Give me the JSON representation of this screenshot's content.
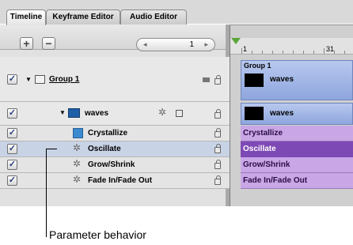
{
  "tabs": [
    "Timeline",
    "Keyframe Editor",
    "Audio Editor"
  ],
  "toolbar": {
    "add_label": "+",
    "remove_label": "−",
    "stepper_left": "◂",
    "stepper_value": "1",
    "stepper_right": "▸"
  },
  "layers": [
    {
      "name": "Group 1",
      "checked": true
    },
    {
      "name": "waves",
      "checked": true
    },
    {
      "name": "Crystallize",
      "checked": true
    },
    {
      "name": "Oscillate",
      "checked": true,
      "selected": true
    },
    {
      "name": "Grow/Shrink",
      "checked": true
    },
    {
      "name": "Fade In/Fade Out",
      "checked": true
    }
  ],
  "ruler": {
    "start": "1",
    "mark": "31"
  },
  "tracks": {
    "group_label": "Group 1",
    "group_clip": "waves",
    "waves_clip": "waves",
    "behaviors": [
      "Crystallize",
      "Oscillate",
      "Grow/Shrink",
      "Fade In/Fade Out"
    ]
  },
  "callout": "Parameter behavior",
  "colors": {
    "selected_row": "#c9d3e6",
    "track_blue": "#8ea6de",
    "track_purple": "#c9a6e6",
    "track_selected": "#7d49b5"
  }
}
